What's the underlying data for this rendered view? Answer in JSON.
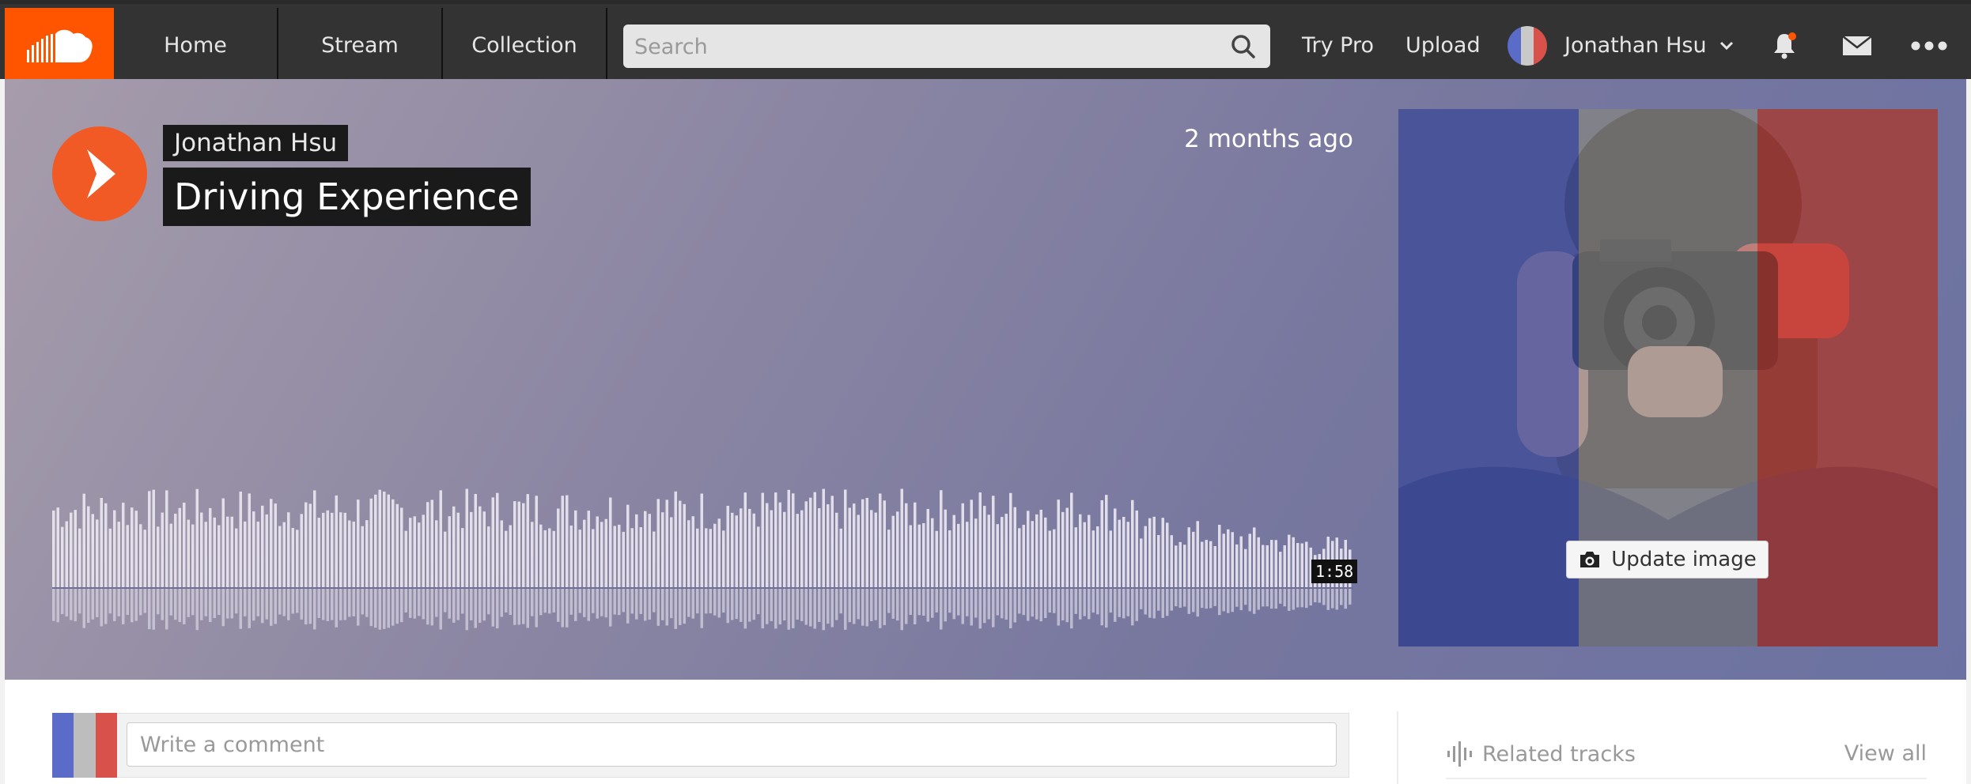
{
  "nav": {
    "tabs": [
      "Home",
      "Stream",
      "Collection"
    ],
    "search_placeholder": "Search",
    "try_pro": "Try Pro",
    "upload": "Upload",
    "username": "Jonathan Hsu",
    "icons": [
      "soundcloud-logo",
      "search-icon",
      "chevron-down-icon",
      "bell-icon",
      "mail-icon",
      "more-icon"
    ],
    "notification_dot_color": "#ff5500"
  },
  "track": {
    "artist": "Jonathan Hsu",
    "title": "Driving Experience",
    "posted": "2 months ago",
    "duration": "1:58",
    "update_image": "Update image"
  },
  "comment": {
    "placeholder": "Write a comment"
  },
  "sidebar": {
    "related_tracks": "Related tracks",
    "view_all": "View all"
  },
  "colors": {
    "accent": "#ff5500",
    "play_button": "#f15a24",
    "header_bg": "#333333",
    "flag_blue": "#4a5fd0",
    "flag_white": "#e8e8e8",
    "flag_red": "#e0443b"
  }
}
